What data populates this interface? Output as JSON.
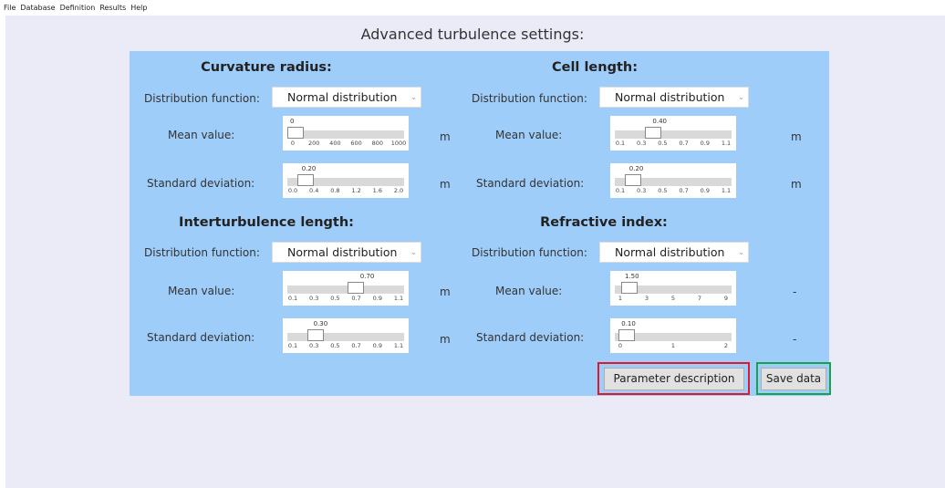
{
  "menu": [
    "File",
    "Database",
    "Definition",
    "Results",
    "Help"
  ],
  "window_title": "Advanced turbulence settings:",
  "sections": {
    "curvature": {
      "title": "Curvature radius:",
      "dist_label": "Distribution function:",
      "dist_value": "Normal distribution",
      "mean": {
        "label": "Mean value:",
        "value": "0",
        "fraction": 0.0,
        "ticks": [
          "0",
          "200",
          "400",
          "600",
          "800",
          "1000"
        ],
        "unit": "m"
      },
      "std": {
        "label": "Standard deviation:",
        "value": "0.20",
        "fraction": 0.1,
        "ticks": [
          "0.0",
          "0.4",
          "0.8",
          "1.2",
          "1.6",
          "2.0"
        ],
        "unit": "m"
      }
    },
    "cell": {
      "title": "Cell length:",
      "dist_label": "Distribution function:",
      "dist_value": "Normal distribution",
      "mean": {
        "label": "Mean value:",
        "value": "0.40",
        "fraction": 0.3,
        "ticks": [
          "0.1",
          "0.3",
          "0.5",
          "0.7",
          "0.9",
          "1.1"
        ],
        "unit": "m"
      },
      "std": {
        "label": "Standard deviation:",
        "value": "0.20",
        "fraction": 0.1,
        "ticks": [
          "0.1",
          "0.3",
          "0.5",
          "0.7",
          "0.9",
          "1.1"
        ],
        "unit": "m"
      }
    },
    "inter": {
      "title": "Interturbulence length:",
      "dist_label": "Distribution function:",
      "dist_value": "Normal distribution",
      "mean": {
        "label": "Mean value:",
        "value": "0.70",
        "fraction": 0.6,
        "ticks": [
          "0.1",
          "0.3",
          "0.5",
          "0.7",
          "0.9",
          "1.1"
        ],
        "unit": "m"
      },
      "std": {
        "label": "Standard deviation:",
        "value": "0.30",
        "fraction": 0.2,
        "ticks": [
          "0.1",
          "0.3",
          "0.5",
          "0.7",
          "0.9",
          "1.1"
        ],
        "unit": "m"
      }
    },
    "refr": {
      "title": "Refractive index:",
      "dist_label": "Distribution function:",
      "dist_value": "Normal distribution",
      "mean": {
        "label": "Mean value:",
        "value": "1.50",
        "fraction": 0.0625,
        "ticks": [
          "1",
          "3",
          "5",
          "7",
          "9"
        ],
        "unit": "-"
      },
      "std": {
        "label": "Standard deviation:",
        "value": "0.10",
        "fraction": 0.0333,
        "ticks": [
          "0",
          "1",
          "2"
        ],
        "unit": "-"
      }
    }
  },
  "buttons": {
    "param_desc": "Parameter description",
    "save": "Save data"
  },
  "colors": {
    "panel": "#9fcdfa",
    "background": "#ebebf7",
    "highlight_red": "#e0192a",
    "highlight_green": "#17a34a"
  }
}
